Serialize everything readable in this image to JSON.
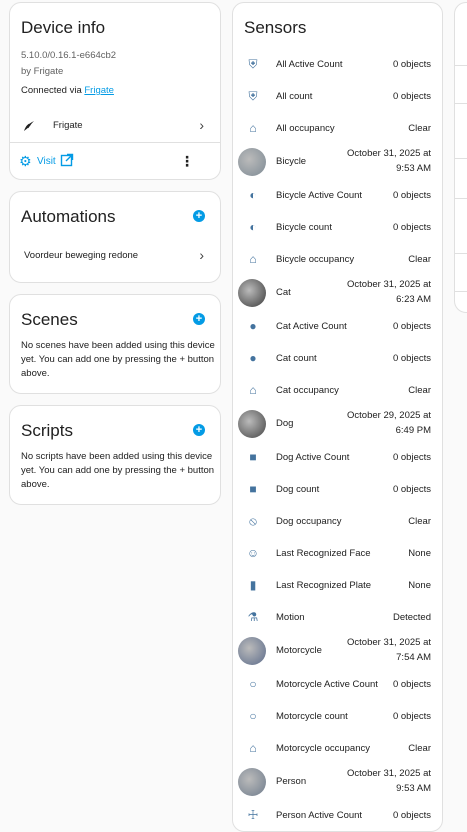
{
  "device_info": {
    "title": "Device info",
    "version": "5.10.0/0.16.1-e664cb2",
    "by": "by Frigate",
    "connected_prefix": "Connected via ",
    "connected_link": "Frigate",
    "integration_name": "Frigate",
    "visit_label": "Visit"
  },
  "automations": {
    "title": "Automations",
    "items": [
      "Voordeur beweging redone"
    ]
  },
  "scenes": {
    "title": "Scenes",
    "empty_text": "No scenes have been added using this device yet. You can add one by pressing the + button above."
  },
  "scripts": {
    "title": "Scripts",
    "empty_text": "No scripts have been added using this device yet. You can add one by pressing the + button above."
  },
  "sensors": {
    "title": "Sensors",
    "rows": [
      {
        "name": "All Active Count",
        "value": "0 objects",
        "icon": "shield-icon"
      },
      {
        "name": "All count",
        "value": "0 objects",
        "icon": "shield-icon"
      },
      {
        "name": "All occupancy",
        "value": "Clear",
        "icon": "home-icon"
      },
      {
        "name": "Bicycle",
        "value_line1": "October 31, 2025 at",
        "value_line2": "9:53 AM",
        "icon": "bicycle-avatar"
      },
      {
        "name": "Bicycle Active Count",
        "value": "0 objects",
        "icon": "bicycle-icon"
      },
      {
        "name": "Bicycle count",
        "value": "0 objects",
        "icon": "bicycle-icon"
      },
      {
        "name": "Bicycle occupancy",
        "value": "Clear",
        "icon": "home-icon"
      },
      {
        "name": "Cat",
        "value_line1": "October 31, 2025 at",
        "value_line2": "6:23 AM",
        "icon": "cat-avatar"
      },
      {
        "name": "Cat Active Count",
        "value": "0 objects",
        "icon": "cat-icon"
      },
      {
        "name": "Cat count",
        "value": "0 objects",
        "icon": "cat-icon"
      },
      {
        "name": "Cat occupancy",
        "value": "Clear",
        "icon": "home-icon"
      },
      {
        "name": "Dog",
        "value_line1": "October 29, 2025 at",
        "value_line2": "6:49 PM",
        "icon": "dog-avatar"
      },
      {
        "name": "Dog Active Count",
        "value": "0 objects",
        "icon": "dog-icon"
      },
      {
        "name": "Dog count",
        "value": "0 objects",
        "icon": "dog-icon"
      },
      {
        "name": "Dog occupancy",
        "value": "Clear",
        "icon": "dog-off-icon"
      },
      {
        "name": "Last Recognized Face",
        "value": "None",
        "icon": "face-recognition-icon"
      },
      {
        "name": "Last Recognized Plate",
        "value": "None",
        "icon": "barcode-icon"
      },
      {
        "name": "Motion",
        "value": "Detected",
        "icon": "motion-icon"
      },
      {
        "name": "Motorcycle",
        "value_line1": "October 31, 2025 at",
        "value_line2": "7:54 AM",
        "icon": "motorcycle-avatar"
      },
      {
        "name": "Motorcycle Active Count",
        "value": "0 objects",
        "icon": "motorbike-icon"
      },
      {
        "name": "Motorcycle count",
        "value": "0 objects",
        "icon": "motorbike-icon"
      },
      {
        "name": "Motorcycle occupancy",
        "value": "Clear",
        "icon": "home-icon"
      },
      {
        "name": "Person",
        "value_line1": "October 31, 2025 at",
        "value_line2": "9:53 AM",
        "icon": "person-avatar"
      },
      {
        "name": "Person Active Count",
        "value": "0 objects",
        "icon": "person-icon"
      }
    ]
  },
  "colors": {
    "accent": "#039be5",
    "icon": "#44739e"
  }
}
